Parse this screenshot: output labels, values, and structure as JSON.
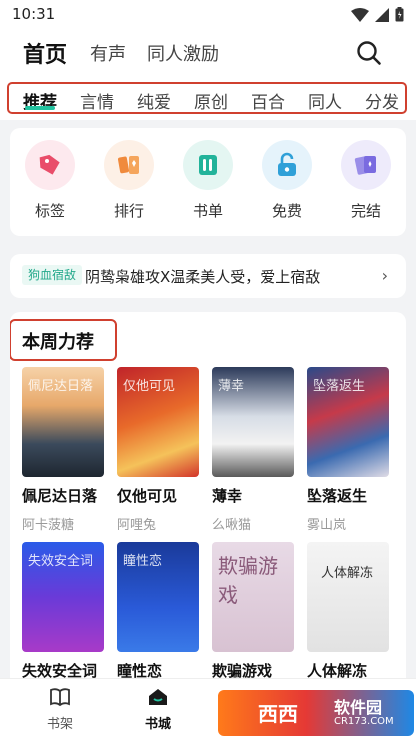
{
  "status": {
    "time": "10:31"
  },
  "top_nav": {
    "tabs": [
      "首页",
      "有声",
      "同人激励"
    ]
  },
  "categories": [
    "推荐",
    "言情",
    "纯爱",
    "原创",
    "百合",
    "同人",
    "分发"
  ],
  "quick_entries": [
    {
      "label": "标签",
      "icon": "tag-icon",
      "color": "#e94d6a",
      "bg": "#fde9ee"
    },
    {
      "label": "排行",
      "icon": "ranking-icon",
      "color": "#f08a3c",
      "bg": "#fdf0e6"
    },
    {
      "label": "书单",
      "icon": "booklist-icon",
      "color": "#22b39a",
      "bg": "#e4f6f2"
    },
    {
      "label": "免费",
      "icon": "unlock-icon",
      "color": "#2fa0d8",
      "bg": "#e5f3fb"
    },
    {
      "label": "完结",
      "icon": "cards-icon",
      "color": "#7a6be0",
      "bg": "#eeebfb"
    }
  ],
  "promo": {
    "tag": "狗血宿敌",
    "text": "阴鸷枭雄攻X温柔美人受，爱上宿敌"
  },
  "weekly": {
    "title": "本周力荐",
    "books": [
      {
        "name": "佩尼达日落",
        "author": "阿卡菠糖",
        "cover_text": "佩尼达日落",
        "cover": "linear-gradient(180deg,#f6d2a8 0%,#e7a86a 35%,#3b4a5c 70%,#1e2630 100%)"
      },
      {
        "name": "仅他可见",
        "author": "阿哩兔",
        "cover_text": "仅他可见",
        "cover": "linear-gradient(160deg,#c0242a 0%,#e86a2a 45%,#f5c25a 75%,#d2342a 100%)"
      },
      {
        "name": "薄幸",
        "author": "么啾猫",
        "cover_text": "薄幸",
        "cover": "linear-gradient(180deg,#2c3a5a 0%,#d7dde6 45%,#f2f2f2 70%,#5a5a5a 100%)"
      },
      {
        "name": "坠落返生",
        "author": "雾山岚",
        "cover_text": "坠落返生",
        "cover": "linear-gradient(160deg,#2a4a8a 0%,#c63a4a 40%,#3a6ab0 70%,#e0dce6 100%)"
      },
      {
        "name": "失效安全词",
        "author": "",
        "cover_text": "失效安全词",
        "cover": "linear-gradient(180deg,#2a5be8 0%,#6a3ad8 50%,#a83ac8 100%)"
      },
      {
        "name": "瞳性恋",
        "author": "",
        "cover_text": "瞳性恋",
        "cover": "linear-gradient(180deg,#1a3a9a 0%,#2a5ad8 60%,#3a7ae8 100%)"
      },
      {
        "name": "欺骗游戏",
        "author": "",
        "cover_text": "欺骗游戏",
        "cover": "linear-gradient(180deg,#e8dae6 0%,#d8c2d2 100%)"
      },
      {
        "name": "人体解冻",
        "author": "",
        "cover_text": "人体解冻",
        "cover": "linear-gradient(180deg,#f4f4f4 0%,#e2e2e2 100%)"
      }
    ]
  },
  "bottom_nav": {
    "tabs": [
      "书架",
      "书城"
    ]
  },
  "watermark": {
    "text1": "西西",
    "text2": "软件园",
    "url": "CR173.COM"
  }
}
